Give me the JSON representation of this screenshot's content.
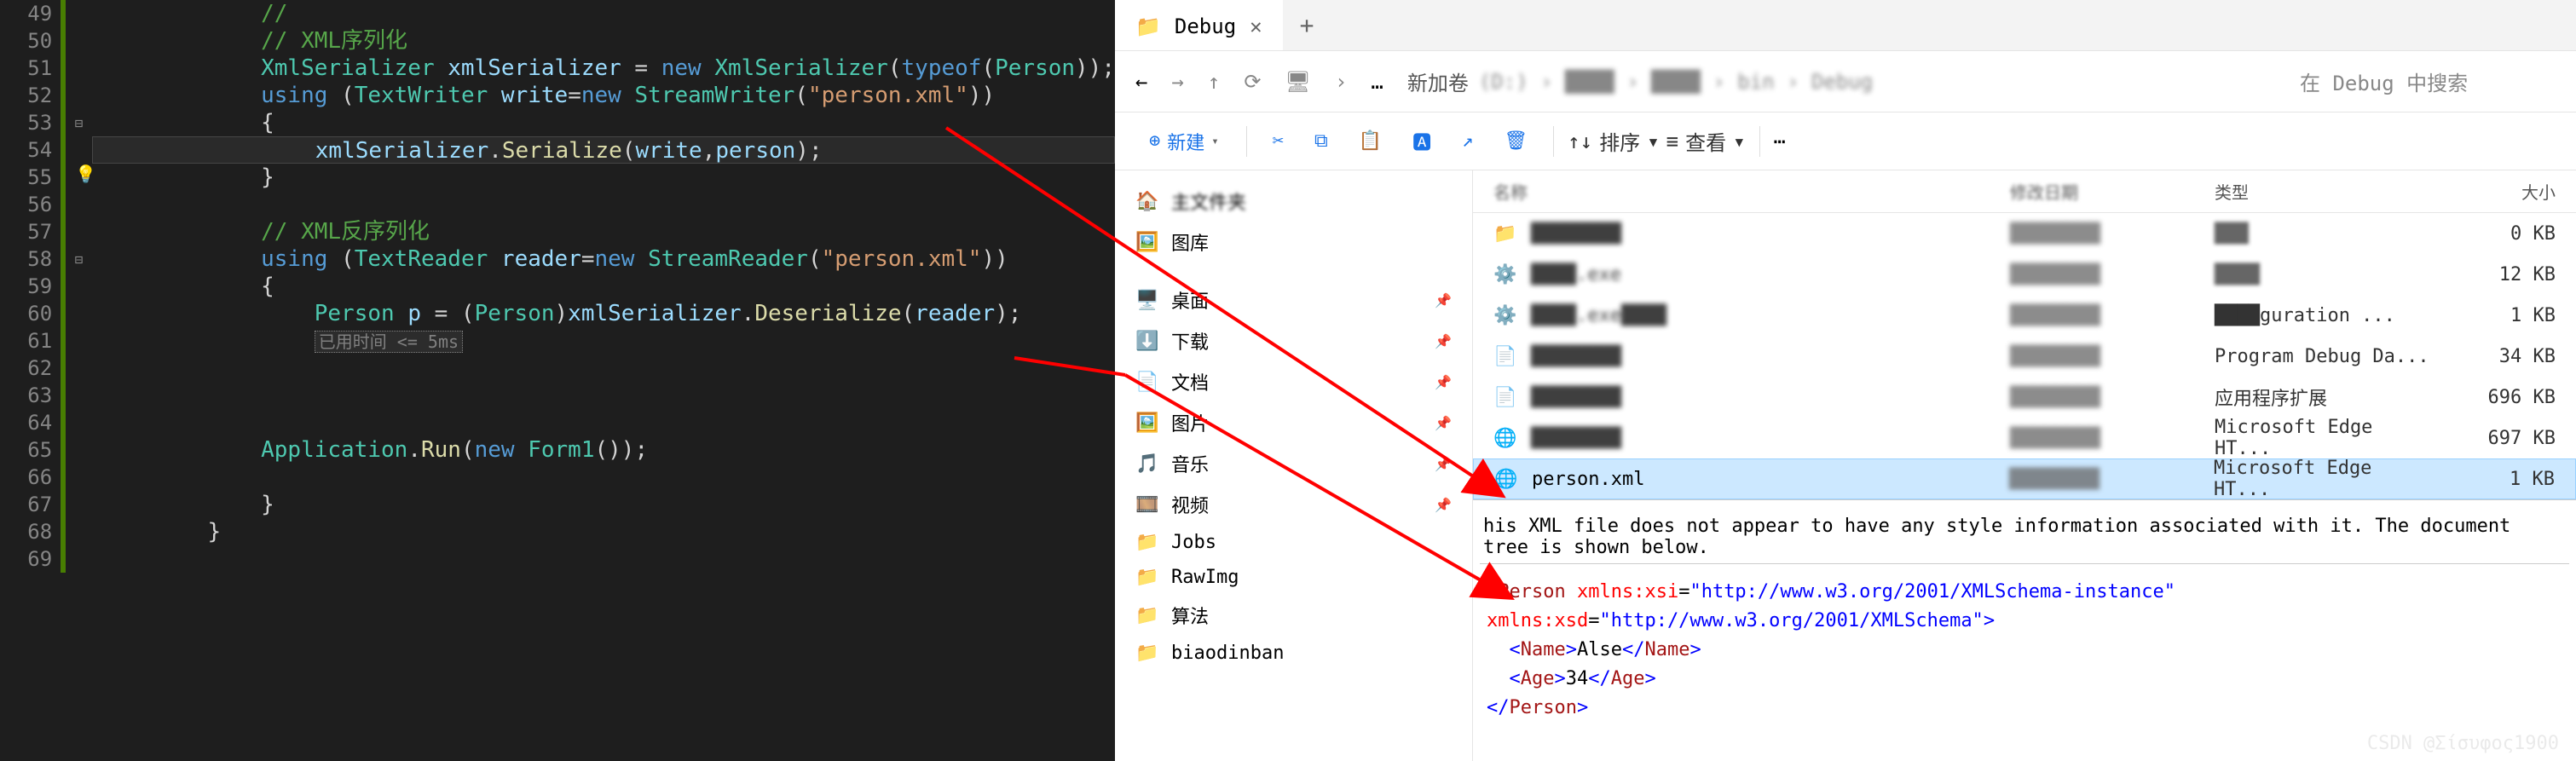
{
  "editor": {
    "lines": [
      {
        "n": 49,
        "html": "<span class='comment'>//</span>"
      },
      {
        "n": 50,
        "html": "<span class='comment'>// XML序列化</span>"
      },
      {
        "n": 51,
        "html": "<span class='type'>XmlSerializer</span> <span class='var'>xmlSerializer</span> = <span class='kw'>new</span> <span class='type'>XmlSerializer</span>(<span class='kw'>typeof</span>(<span class='type'>Person</span>));"
      },
      {
        "n": 52,
        "html": "<span class='kw'>using</span> (<span class='type'>TextWriter</span> <span class='var'>write</span>=<span class='kw'>new</span> <span class='type'>StreamWriter</span>(<span class='str'>\"person.xml\"</span>))"
      },
      {
        "n": 53,
        "html": "{",
        "fold": true
      },
      {
        "n": 54,
        "html": "    <span class='var'>xmlSerializer</span>.<span class='method'>Serialize</span>(<span class='var'>write</span>,<span class='var'>person</span>);",
        "current": true,
        "bulb": true
      },
      {
        "n": 55,
        "html": "}"
      },
      {
        "n": 56,
        "html": ""
      },
      {
        "n": 57,
        "html": "<span class='comment'>// XML反序列化</span>"
      },
      {
        "n": 58,
        "html": "<span class='kw'>using</span> (<span class='type'>TextReader</span> <span class='var'>reader</span>=<span class='kw'>new</span> <span class='type'>StreamReader</span>(<span class='str'>\"person.xml\"</span>))",
        "fold": true
      },
      {
        "n": 59,
        "html": "{"
      },
      {
        "n": 60,
        "html": "    <span class='type'>Person</span> <span class='var'>p</span> = (<span class='type'>Person</span>)<span class='var'>xmlSerializer</span>.<span class='method'>Deserialize</span>(<span class='var'>reader</span>);"
      },
      {
        "n": 61,
        "html": "<span class='perf'>已用时间 &lt;= 5ms</span>",
        "indent": "    "
      },
      {
        "n": 62,
        "html": ""
      },
      {
        "n": 63,
        "html": ""
      },
      {
        "n": 64,
        "html": ""
      },
      {
        "n": 65,
        "html": "<span class='type'>Application</span>.<span class='method'>Run</span>(<span class='kw'>new</span> <span class='type'>Form1</span>());"
      },
      {
        "n": 66,
        "html": ""
      },
      {
        "n": 67,
        "html": "}"
      },
      {
        "n": 68,
        "html": "}"
      },
      {
        "n": 69,
        "html": ""
      }
    ],
    "base_indent": "            "
  },
  "explorer": {
    "tab_title": "Debug",
    "address_prefix": "新加卷",
    "search_placeholder": "在 Debug 中搜索",
    "toolbar": {
      "new": "新建",
      "sort": "排序",
      "view": "查看"
    },
    "headers": {
      "name": "名称",
      "date": "修改日期",
      "type": "类型",
      "size": "大小"
    },
    "sidebar": [
      {
        "icon": "🏠",
        "label": "主文件夹",
        "blur": true
      },
      {
        "icon": "🖼️",
        "label": "图库"
      },
      {
        "sep": true
      },
      {
        "icon": "🖥️",
        "label": "桌面",
        "pin": true
      },
      {
        "icon": "⬇️",
        "label": "下载",
        "pin": true
      },
      {
        "icon": "📄",
        "label": "文档",
        "pin": true
      },
      {
        "icon": "🖼️",
        "label": "图片",
        "pin": true
      },
      {
        "icon": "🎵",
        "label": "音乐",
        "pin": true
      },
      {
        "icon": "🎞️",
        "label": "视频",
        "pin": true
      },
      {
        "icon": "📁",
        "label": "Jobs"
      },
      {
        "icon": "📁",
        "label": "RawImg"
      },
      {
        "icon": "📁",
        "label": "算法"
      },
      {
        "icon": "📁",
        "label": "biaodinban"
      }
    ],
    "files": [
      {
        "icon": "📁",
        "name": "████████",
        "type": "███",
        "size": "0 KB",
        "blur": true,
        "typeblur": true
      },
      {
        "icon": "⚙️",
        "name": "████.exe",
        "type": "████",
        "size": "12 KB",
        "blur": true,
        "typeblur": true
      },
      {
        "icon": "⚙️",
        "name": "████.exe████",
        "type": "████guration ...",
        "size": "1 KB",
        "blur": true
      },
      {
        "icon": "📄",
        "name": "████████",
        "type": "Program Debug Da...",
        "size": "34 KB",
        "blur": true
      },
      {
        "icon": "📄",
        "name": "████████",
        "type": "应用程序扩展",
        "size": "696 KB",
        "blur": true
      },
      {
        "icon": "🌐",
        "name": "████████",
        "type": "Microsoft Edge HT...",
        "size": "697 KB",
        "blur": true
      },
      {
        "icon": "🌐",
        "name": "person.xml",
        "type": "Microsoft Edge HT...",
        "size": "1 KB",
        "selected": true
      }
    ],
    "preview": {
      "info": "his XML file does not appear to have any style information associated with it. The document tree is shown below.",
      "xml": {
        "root_open": "<Person xmlns:xsi=\"http://www.w3.org/2001/XMLSchema-instance\" xmlns:xsd=\"http://www.w3.org/2001/XMLSchema\">",
        "name_label": "Name",
        "name_value": "Alse",
        "age_label": "Age",
        "age_value": "34",
        "root_close": "</Person>"
      }
    }
  },
  "watermark": "CSDN @Σίσυφος1900"
}
